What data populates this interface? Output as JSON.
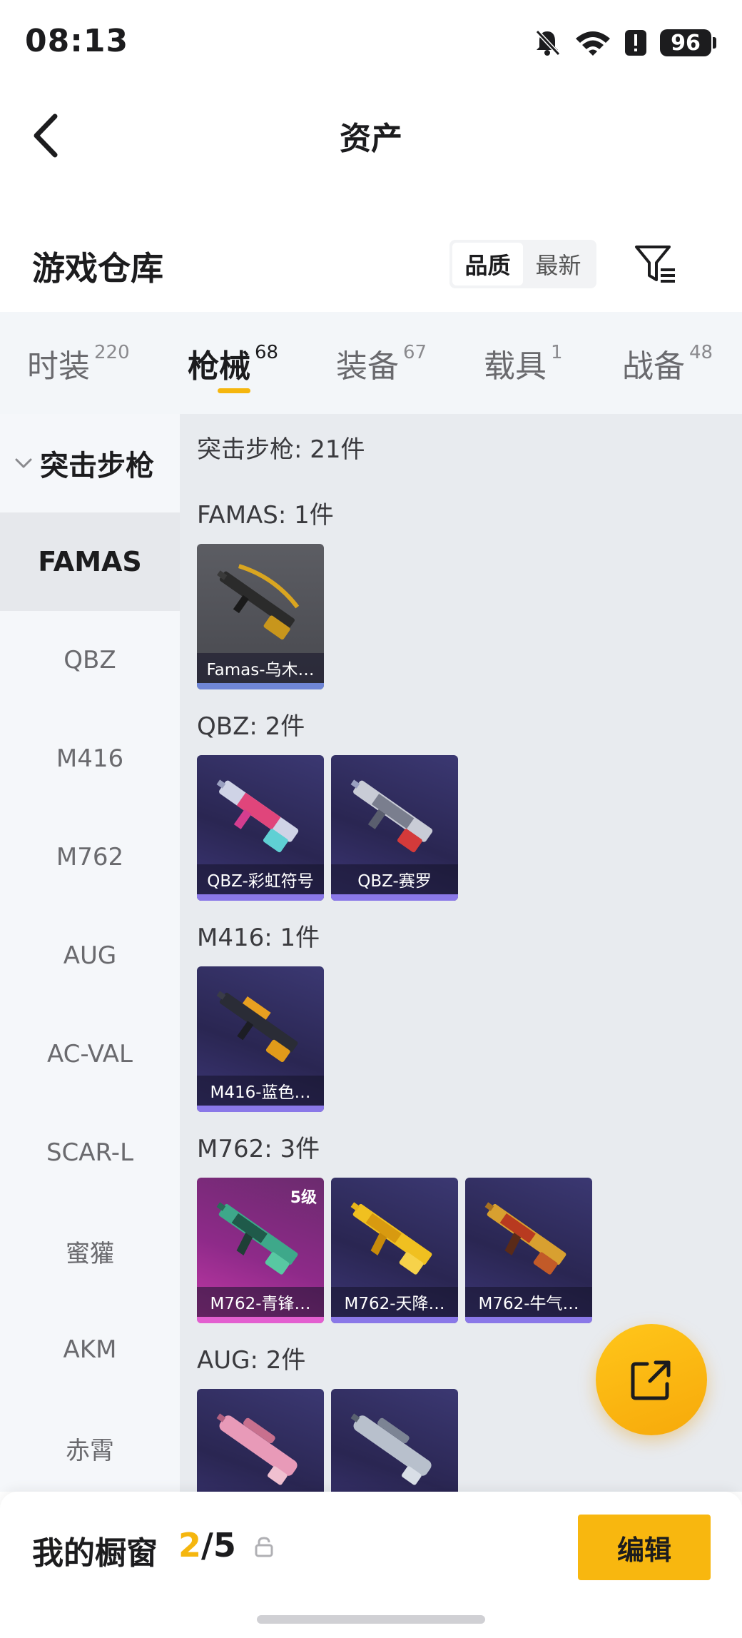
{
  "status_bar": {
    "time": "08:13",
    "battery": "96",
    "icons": [
      "bell-mute-icon",
      "wifi-icon",
      "alert-icon",
      "battery-icon"
    ]
  },
  "header": {
    "title": "资产"
  },
  "warehouse": {
    "title": "游戏仓库",
    "sort_options": [
      "品质",
      "最新"
    ],
    "selected_sort": "品质"
  },
  "tabs": [
    {
      "label": "时装",
      "count": "220"
    },
    {
      "label": "枪械",
      "count": "68"
    },
    {
      "label": "装备",
      "count": "67"
    },
    {
      "label": "载具",
      "count": "1"
    },
    {
      "label": "战备",
      "count": "48"
    }
  ],
  "active_tab": "枪械",
  "sidebar": {
    "group": "突击步枪",
    "items": [
      "FAMAS",
      "QBZ",
      "M416",
      "M762",
      "AUG",
      "AC-VAL",
      "SCAR-L",
      "蜜獾",
      "AKM",
      "赤霄"
    ],
    "active_item": "FAMAS"
  },
  "content": {
    "heading": "突击步枪: 21件",
    "groups": [
      {
        "title": "FAMAS: 1件",
        "items": [
          {
            "name": "Famas-乌木…",
            "rarity": "gray"
          }
        ]
      },
      {
        "title": "QBZ: 2件",
        "items": [
          {
            "name": "QBZ-彩虹符号",
            "rarity": "purple"
          },
          {
            "name": "QBZ-赛罗",
            "rarity": "purple"
          }
        ]
      },
      {
        "title": "M416: 1件",
        "items": [
          {
            "name": "M416-蓝色…",
            "rarity": "purple"
          }
        ]
      },
      {
        "title": "M762: 3件",
        "items": [
          {
            "name": "M762-青锋…",
            "rarity": "pink",
            "level": "5级"
          },
          {
            "name": "M762-天降…",
            "rarity": "purple"
          },
          {
            "name": "M762-牛气…",
            "rarity": "purple"
          }
        ]
      },
      {
        "title": "AUG: 2件",
        "items": [
          {
            "name": "",
            "rarity": "purple"
          },
          {
            "name": "",
            "rarity": "purple"
          }
        ]
      }
    ]
  },
  "showcase": {
    "title": "我的橱窗",
    "current": "2",
    "separator": "/",
    "total": "5",
    "edit_label": "编辑"
  },
  "colors": {
    "accent": "#f5b60e",
    "rarity_gray": "#6f86d6",
    "rarity_purple": "#8a78e8",
    "rarity_pink": "#e35fd0"
  }
}
